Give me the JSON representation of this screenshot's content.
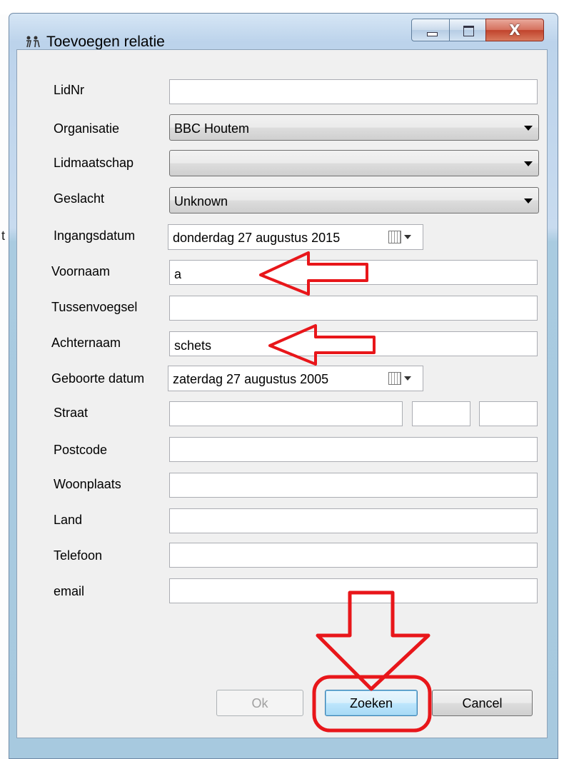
{
  "window": {
    "title": "Toevoegen relatie",
    "close_glyph": "X",
    "buttons": [
      "minimize-button",
      "maximize-button",
      "close-button"
    ]
  },
  "form": {
    "lidnr": {
      "label": "LidNr",
      "value": ""
    },
    "organisatie": {
      "label": "Organisatie",
      "value": "BBC Houtem"
    },
    "lidmaatschap": {
      "label": "Lidmaatschap",
      "value": ""
    },
    "geslacht": {
      "label": "Geslacht",
      "value": "Unknown"
    },
    "ingangsdatum": {
      "label": "Ingangsdatum",
      "value": "donderdag 27  augustus  2015"
    },
    "voornaam": {
      "label": "Voornaam",
      "value": "a"
    },
    "tussenvoegsel": {
      "label": "Tussenvoegsel",
      "value": ""
    },
    "achternaam": {
      "label": "Achternaam",
      "value": "schets"
    },
    "geboortedatum": {
      "label": "Geboorte datum",
      "value": "zaterdag   27  augustus  2005"
    },
    "straat": {
      "label": "Straat",
      "value": "",
      "nummer": "",
      "toevoeging": ""
    },
    "postcode": {
      "label": "Postcode",
      "value": ""
    },
    "woonplaats": {
      "label": "Woonplaats",
      "value": ""
    },
    "land": {
      "label": "Land",
      "value": ""
    },
    "telefoon": {
      "label": "Telefoon",
      "value": ""
    },
    "email": {
      "label": "email",
      "value": ""
    }
  },
  "actions": {
    "ok": "Ok",
    "zoeken": "Zoeken",
    "cancel": "Cancel"
  },
  "annotation": {
    "color": "#e8161a"
  },
  "edge_text": "t"
}
